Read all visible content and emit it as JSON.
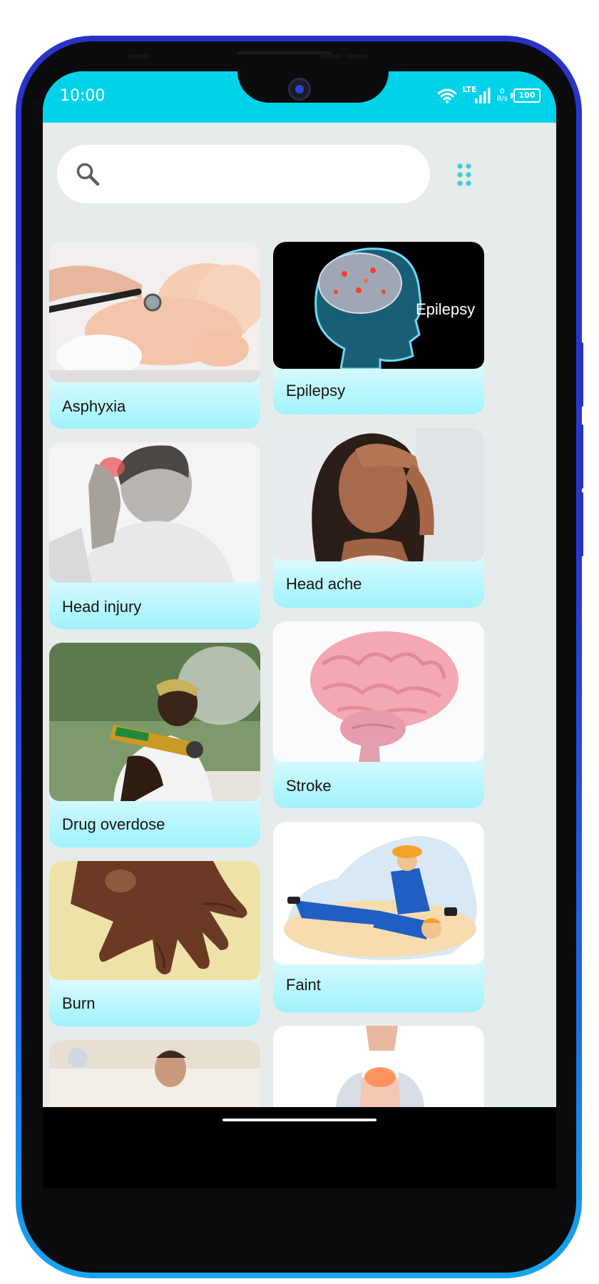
{
  "status_bar": {
    "time": "10:00",
    "network_type": "LTE",
    "speed_value": "0",
    "speed_unit": "B/s",
    "battery": "100"
  },
  "search": {
    "placeholder": ""
  },
  "cards": [
    {
      "label": "Asphyxia",
      "image": "baby-stethoscope"
    },
    {
      "label": "Epilepsy",
      "image": "brain-xray-head",
      "overlay_text": "Epilepsy"
    },
    {
      "label": "Head injury",
      "image": "man-holding-head"
    },
    {
      "label": "Head ache",
      "image": "woman-headache"
    },
    {
      "label": "Drug overdose",
      "image": "man-smoking"
    },
    {
      "label": "Stroke",
      "image": "brain-model"
    },
    {
      "label": "Burn",
      "image": "burned-hand"
    },
    {
      "label": "Faint",
      "image": "worker-recovery-position"
    }
  ],
  "colors": {
    "status_bar": "#00d2ec",
    "background": "#e6ebeb",
    "card_gradient_bottom": "#9ff2fc",
    "grid_icon": "#3ccfd6",
    "phone_frame": "#2a33c9"
  }
}
